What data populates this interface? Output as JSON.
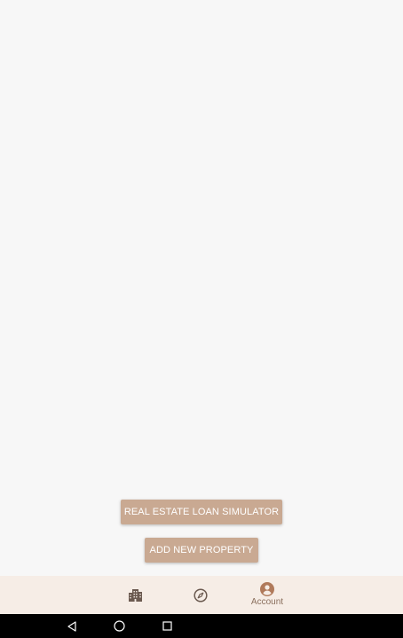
{
  "actions": {
    "loan_simulator_label": "REAL ESTATE LOAN SIMULATOR",
    "add_property_label": "ADD NEW PROPERTY"
  },
  "bottom_nav": {
    "items": [
      {
        "icon": "building-icon",
        "label": ""
      },
      {
        "icon": "compass-icon",
        "label": ""
      },
      {
        "icon": "account-circle-icon",
        "label": "Account",
        "active": true
      }
    ]
  },
  "system_nav": {
    "back_icon": "back-triangle-icon",
    "home_icon": "home-circle-icon",
    "recents_icon": "recents-square-icon"
  },
  "colors": {
    "accent": "#c9a992",
    "nav_background": "#f6ede6",
    "active_icon": "#b07a5b",
    "inactive_icon": "#6b5a50",
    "page_background": "#f7f7f7"
  }
}
